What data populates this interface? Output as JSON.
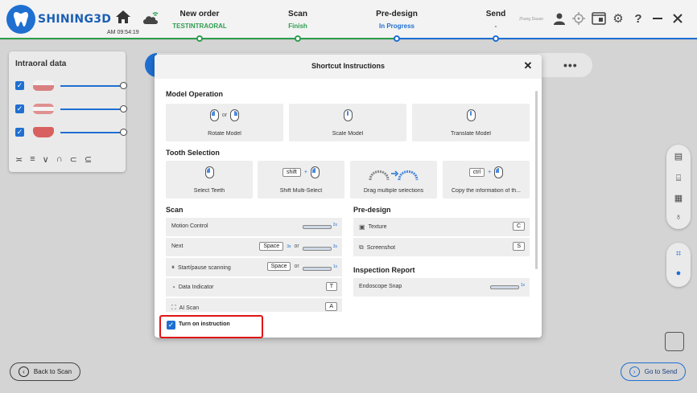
{
  "app": {
    "brand": "SHINING3D",
    "time": "AM 09:54:19",
    "user_name": "Zhang Dasan"
  },
  "steps": [
    {
      "name": "New order",
      "status": "TESTINTRAORAL"
    },
    {
      "name": "Scan",
      "status": "Finish"
    },
    {
      "name": "Pre-design",
      "status": "In Progress"
    },
    {
      "name": "Send",
      "status": "-"
    }
  ],
  "left_panel": {
    "title": "Intraoral data"
  },
  "bottom": {
    "back_label": "Back to Scan",
    "send_label": "Go to Send"
  },
  "dialog": {
    "title": "Shortcut Instructions",
    "model_operation": {
      "heading": "Model Operation",
      "items": [
        {
          "label": "Rotate Model",
          "or": "or"
        },
        {
          "label": "Scale Model"
        },
        {
          "label": "Translate Model"
        }
      ]
    },
    "tooth_selection": {
      "heading": "Tooth Selection",
      "items": [
        {
          "label": "Select Teeth"
        },
        {
          "label": "Shift Multi-Select",
          "key": "shift"
        },
        {
          "label": "Drag multiple selections"
        },
        {
          "label": "Copy the information of th...",
          "key": "ctrl"
        }
      ]
    },
    "scan": {
      "heading": "Scan",
      "rows": [
        {
          "label": "Motion Control",
          "badge": "2x"
        },
        {
          "label": "Next",
          "key": "Space",
          "or": "or",
          "badge": "3s",
          "badge2": "3s"
        },
        {
          "label": "Start/pause scanning",
          "key": "Space",
          "or": "or",
          "badge": "1x"
        },
        {
          "label": "Data Indicator",
          "key": "T"
        },
        {
          "label": "AI Scan",
          "key": "A"
        }
      ]
    },
    "pre_design": {
      "heading": "Pre-design",
      "rows": [
        {
          "label": "Texture",
          "key": "C"
        },
        {
          "label": "Screenshot",
          "key": "S"
        }
      ]
    },
    "inspection": {
      "heading": "Inspection Report",
      "rows": [
        {
          "label": "Endoscope Snap",
          "badge": "1x"
        }
      ]
    },
    "footer_checkbox_label": "Turn on instruction"
  },
  "colors": {
    "accent": "#1f6fd1",
    "done": "#2e9e4f",
    "highlight": "#e01515"
  }
}
